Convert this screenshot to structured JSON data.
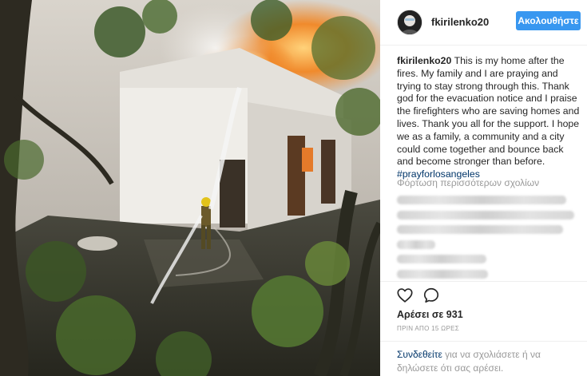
{
  "post": {
    "username": "fkirilenko20",
    "follow_label": "Ακολουθήστε",
    "caption": {
      "username": "fkirilenko20",
      "text": "This is my home after the fires. My family and I are praying and trying to stay strong through this. Thank god for the evacuation notice and I praise the firefighters who are saving homes and lives. Thank you all for the support. I hope we as a family, a community and a city could come together and bounce back and become stronger than before.",
      "hashtag": "#prayforlosangeles"
    },
    "load_more_comments": "Φόρτωση περισσότερων σχολίων",
    "likes": "Αρέσει σε 931",
    "time_ago": "ΠΡΙΝ ΑΠΟ 15 ΩΡΕΣ",
    "login_prompt": {
      "link": "Συνδεθείτε",
      "rest": "για να σχολιάσετε ή να δηλώσετε ότι σας αρέσει."
    },
    "icons": {
      "like": "heart-icon",
      "comment": "comment-bubble-icon"
    },
    "colors": {
      "follow_button": "#3897f0",
      "link": "#003569",
      "muted": "#999999"
    }
  }
}
